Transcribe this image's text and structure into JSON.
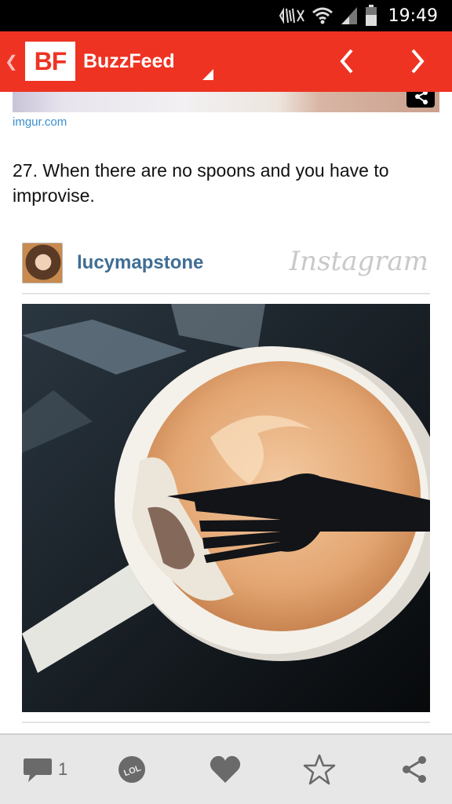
{
  "status_bar": {
    "time": "19:49",
    "icons": [
      "mute-icon",
      "wifi-icon",
      "signal-icon",
      "battery-icon"
    ]
  },
  "app_bar": {
    "logo": "BF",
    "title": "BuzzFeed",
    "back_icon": "chevron-left-icon",
    "prev_icon": "chevron-left-icon",
    "next_icon": "chevron-right-icon",
    "background_color": "#ee3322"
  },
  "article": {
    "source": "imgur.com",
    "item_title": "27. When there are no spoons and you have to improvise.",
    "embed": {
      "username": "lucymapstone",
      "platform": "Instagram"
    }
  },
  "bottom_bar": {
    "comment_count": "1",
    "lol_label": "LOL",
    "icons": [
      "comment-icon",
      "lol-icon",
      "heart-icon",
      "star-icon",
      "share-icon"
    ]
  }
}
